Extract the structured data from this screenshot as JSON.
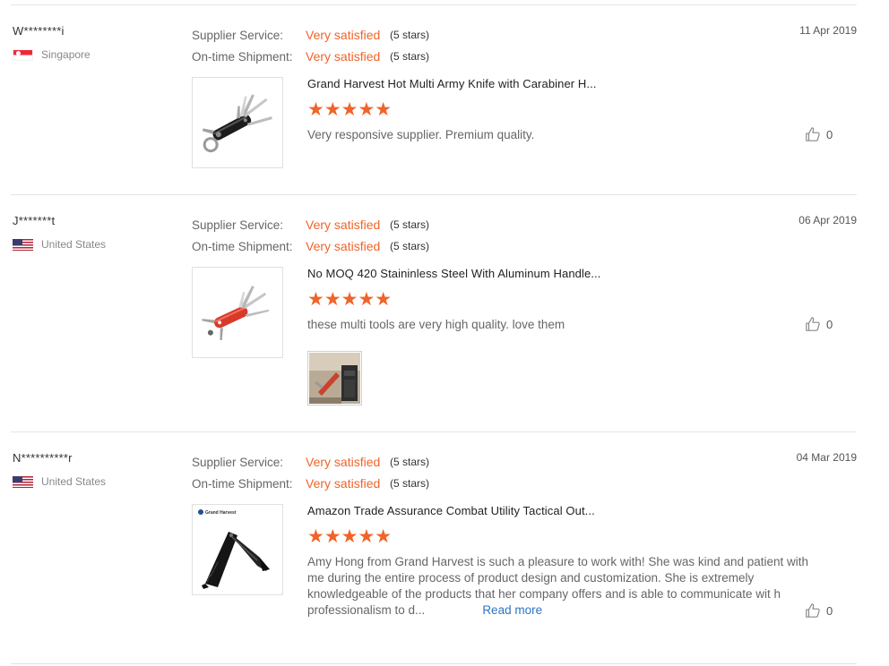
{
  "labels": {
    "supplier_service": "Supplier Service:",
    "ontime_shipment": "On-time Shipment:",
    "read_more": "Read more"
  },
  "colors": {
    "accent": "#f0642a",
    "link": "#2e73c4",
    "divider": "#e4e4e4"
  },
  "reviews": [
    {
      "buyer": "W********i",
      "country": "Singapore",
      "flag": "flag-singapore",
      "supplier_service": "Very satisfied",
      "supplier_service_stars": "(5 stars)",
      "shipment": "Very satisfied",
      "shipment_stars": "(5 stars)",
      "date": "11 Apr 2019",
      "product_title": "Grand Harvest Hot Multi Army Knife with Carabiner H...",
      "rating": 5,
      "stars_display": "★★★★★",
      "text": "Very responsive supplier. Premium quality.",
      "likes": "0",
      "thumbnail": "black-multi-tool-knife"
    },
    {
      "buyer": "J*******t",
      "country": "United States",
      "flag": "flag-united-states",
      "supplier_service": "Very satisfied",
      "supplier_service_stars": "(5 stars)",
      "shipment": "Very satisfied",
      "shipment_stars": "(5 stars)",
      "date": "06 Apr 2019",
      "product_title": "No MOQ 420 Staininless Steel With Aluminum Handle...",
      "rating": 5,
      "stars_display": "★★★★★",
      "text": "these multi tools are very high quality. love them",
      "likes": "0",
      "thumbnail": "red-multi-tool-knife",
      "attachment": "customer-photo"
    },
    {
      "buyer": "N**********r",
      "country": "United States",
      "flag": "flag-united-states",
      "supplier_service": "Very satisfied",
      "supplier_service_stars": "(5 stars)",
      "shipment": "Very satisfied",
      "shipment_stars": "(5 stars)",
      "date": "04 Mar 2019",
      "product_title": "Amazon Trade Assurance Combat Utility Tactical Out...",
      "rating": 5,
      "stars_display": "★★★★★",
      "text": "Amy Hong from Grand Harvest is such a pleasure to work with! She was kind and patient with me during the entire process of product design and customization. She is extremely knowledgeable of the products that her company offers and is able to communicate wit h professionalism to d...",
      "likes": "0",
      "thumbnail": "black-tactical-folding-knife",
      "thumbnail_brand": "Grand Harvest"
    }
  ]
}
